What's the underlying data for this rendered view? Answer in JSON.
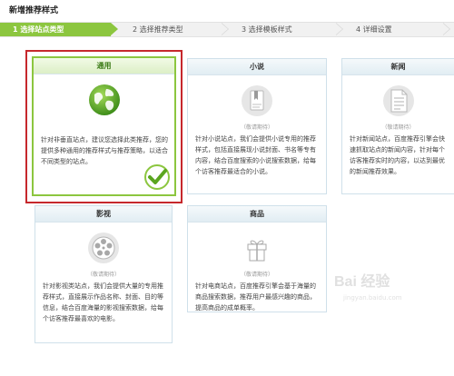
{
  "page_title": "新增推荐样式",
  "steps": [
    {
      "label": "1  选择站点类型",
      "active": true
    },
    {
      "label": "2  选择推荐类型",
      "active": false
    },
    {
      "label": "3  选择模板样式",
      "active": false
    },
    {
      "label": "4  详细设置",
      "active": false
    }
  ],
  "cards": {
    "general": {
      "title": "通用",
      "desc": "针对非垂直站点，建议您选择此类推荐，您的提供多种通用的推荐样式与推荐策略，以适合不同类型的站点。",
      "icon": "globe-icon"
    },
    "novel": {
      "title": "小说",
      "soon": "（敬请期待）",
      "desc": "针对小说站点，我们会提供小说专用的推荐样式，包括直接展现小说封面、书名等专有内容，结合百度搜索的小说搜索数据，给每个访客推荐最适合的小说。",
      "icon": "book-icon"
    },
    "news": {
      "title": "新闻",
      "soon": "（敬请期待）",
      "desc": "针对新闻站点，百度推荐引擎会快速抓取站点的新闻内容，针对每个访客推荐实时的内容，以达到最优的新闻推荐效果。",
      "icon": "document-icon"
    },
    "video": {
      "title": "影视",
      "soon": "（敬请期待）",
      "desc": "针对影视类站点，我们会提供大量的专用推荐样式，直接展示作品名称、封面、目的等信息，结合百度海量的影视搜索数据，给每个访客推荐最喜欢的电影。",
      "icon": "film-reel-icon"
    },
    "goods": {
      "title": "商品",
      "soon": "（敬请期待）",
      "desc": "针对电商站点，百度推荐引擎会基于海量的商品搜索数据，推荐用户最感兴趣的商品，提高商品的成单概率。",
      "icon": "gift-icon"
    }
  },
  "watermark": {
    "logo": "Bai 经验",
    "url": "jingyan.baidu.com"
  },
  "colors": {
    "accent_green": "#8cc63f",
    "selected_red": "#c6282c",
    "card_border": "#cfe0ea"
  }
}
